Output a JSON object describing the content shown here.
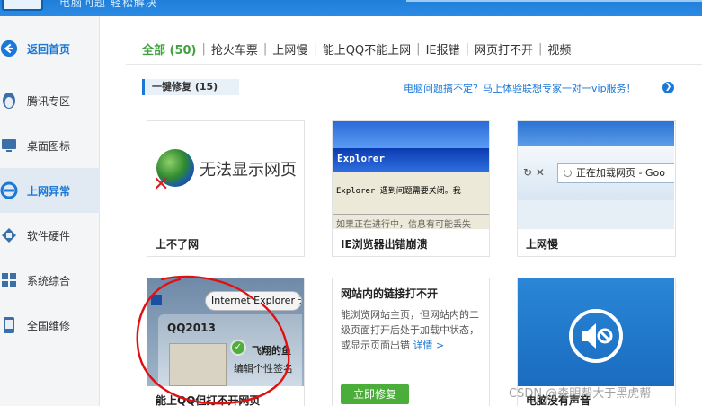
{
  "banner": {
    "text": "电脑问题 轻松解决"
  },
  "sidebar": {
    "items": [
      {
        "label": "返回首页",
        "icon": "back-arrow-icon"
      },
      {
        "label": "腾讯专区",
        "icon": "qq-penguin-icon"
      },
      {
        "label": "桌面图标",
        "icon": "monitor-icon"
      },
      {
        "label": "上网异常",
        "icon": "ie-icon"
      },
      {
        "label": "软件硬件",
        "icon": "chip-icon"
      },
      {
        "label": "系统综合",
        "icon": "windows-icon"
      },
      {
        "label": "全国维修",
        "icon": "phone-icon"
      }
    ],
    "active_index": 3
  },
  "tabs": [
    {
      "label": "全部 (50)"
    },
    {
      "label": "抢火车票"
    },
    {
      "label": "上网慢"
    },
    {
      "label": "能上QQ不能上网"
    },
    {
      "label": "IE报错"
    },
    {
      "label": "网页打不开"
    },
    {
      "label": "视频"
    }
  ],
  "section": {
    "title": "一键修复 (15)"
  },
  "promo": {
    "text": "电脑问题搞不定？马上体验联想专家一对一vip服务！"
  },
  "cards": [
    {
      "title": "上不了网",
      "thumb_text": "无法显示网页"
    },
    {
      "title": "IE浏览器出错崩溃",
      "thumb_bar": "Explorer",
      "thumb_msg": "Explorer 遇到问题需要关闭。我",
      "thumb_cut": "如果正在进行中，信息有可能丢失"
    },
    {
      "title": "上网慢",
      "thumb_buttons": "↻ ✕",
      "thumb_url": "正在加载网页 - Goo"
    },
    {
      "title": "能上QQ但打不开网页",
      "thumb_title": "Internet Explorer 无法显...",
      "thumb_app": "QQ2013",
      "thumb_name": "飞翔的鱼",
      "thumb_sign": "编辑个性签名"
    },
    {
      "title": "网站内的链接打不开",
      "desc": "能浏览网站主页，但网站内的二级页面打开后处于加载中状态，或显示页面出错",
      "more": "详情 >",
      "button": "立即修复"
    },
    {
      "title": "电脑没有声音"
    }
  ],
  "watermark": "CSDN @森明帮大于黑虎帮",
  "colors": {
    "accent_blue": "#1b78d8",
    "accent_green": "#3fa23f",
    "annotation_red": "#e01010"
  }
}
